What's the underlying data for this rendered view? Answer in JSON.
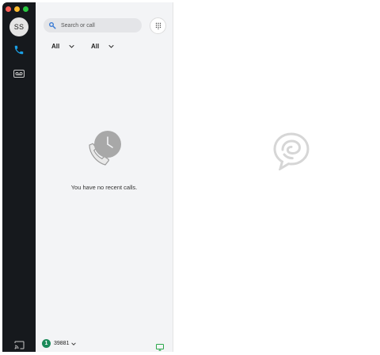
{
  "window": {
    "controls": [
      "close",
      "minimize",
      "zoom"
    ]
  },
  "rail": {
    "avatar_initials": "SS",
    "icons": [
      "phone-icon",
      "voicemail-icon",
      "cast-icon"
    ],
    "active_color": "#1aa0e6"
  },
  "panel": {
    "search": {
      "placeholder": "Search or call"
    },
    "filters": [
      {
        "label": "All"
      },
      {
        "label": "All"
      }
    ],
    "empty_state": "You have no recent calls.",
    "footer": {
      "status_number": "1",
      "extension": "39881",
      "status_color": "#1b8a5a"
    }
  },
  "colors": {
    "rail_bg": "#16191d",
    "panel_bg": "#f3f4f6",
    "accent": "#1aa0e6",
    "device_green": "#2aa84a"
  }
}
